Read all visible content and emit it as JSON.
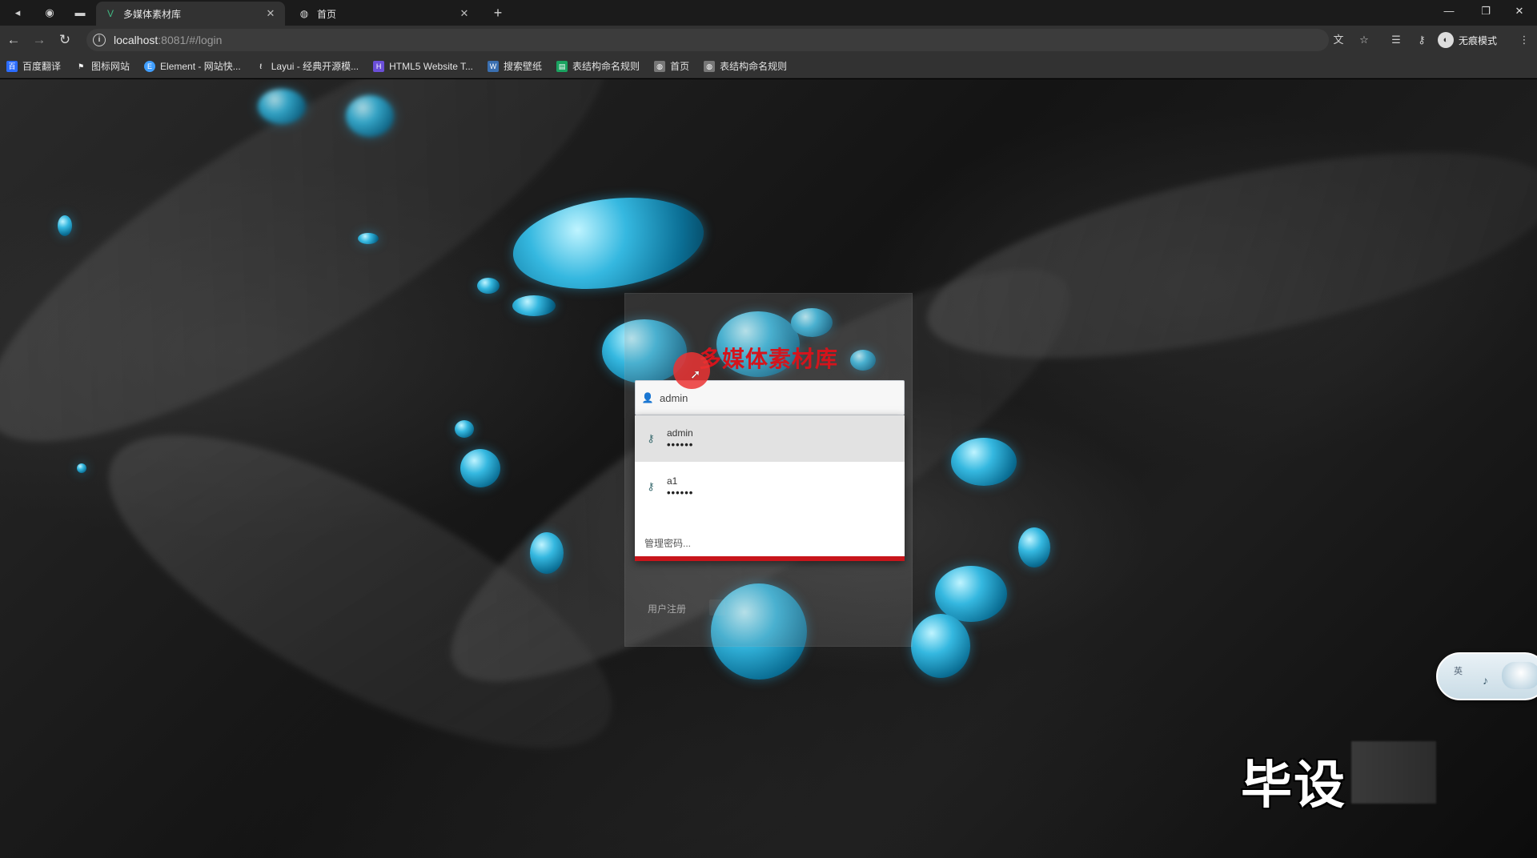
{
  "browser": {
    "tabs": [
      {
        "title": "多媒体素材库",
        "active": true,
        "favicon": "vue-icon"
      },
      {
        "title": "首页",
        "active": false,
        "favicon": "globe-icon"
      }
    ],
    "address": {
      "host": "localhost",
      "rest": ":8081/#/login"
    },
    "profile_label": "无痕模式",
    "bookmarks": [
      {
        "label": "百度翻译",
        "icon": "baidu-translate-icon",
        "color": "#2b6cff"
      },
      {
        "label": "图标网站",
        "icon": "flag-icon",
        "color": "#555555"
      },
      {
        "label": "Element - 网站快...",
        "icon": "element-icon",
        "color": "#409eff"
      },
      {
        "label": "Layui - 经典开源模...",
        "icon": "layui-icon",
        "color": "#444444"
      },
      {
        "label": "HTML5 Website T...",
        "icon": "html5-template-icon",
        "color": "#6b4fd8"
      },
      {
        "label": "搜索壁纸",
        "icon": "wallpaper-icon",
        "color": "#3a6fb0"
      },
      {
        "label": "表结构命名规则",
        "icon": "doc-icon",
        "color": "#1aa260"
      },
      {
        "label": "首页",
        "icon": "globe-icon",
        "color": "#777777"
      },
      {
        "label": "表结构命名规则",
        "icon": "globe-icon",
        "color": "#777777"
      }
    ]
  },
  "login": {
    "title": "多媒体素材库",
    "username_value": "admin",
    "autofill": [
      {
        "user": "admin",
        "password_mask": "••••••"
      },
      {
        "user": "a1",
        "password_mask": "••••••"
      }
    ],
    "manage_label": "管理密码...",
    "register_label": "用户注册"
  },
  "widget": {
    "text": "英"
  },
  "watermark": "毕设",
  "colors": {
    "title_red": "#d4141c",
    "accent_red": "#c8151b",
    "water_blue": "#35b8e0"
  }
}
